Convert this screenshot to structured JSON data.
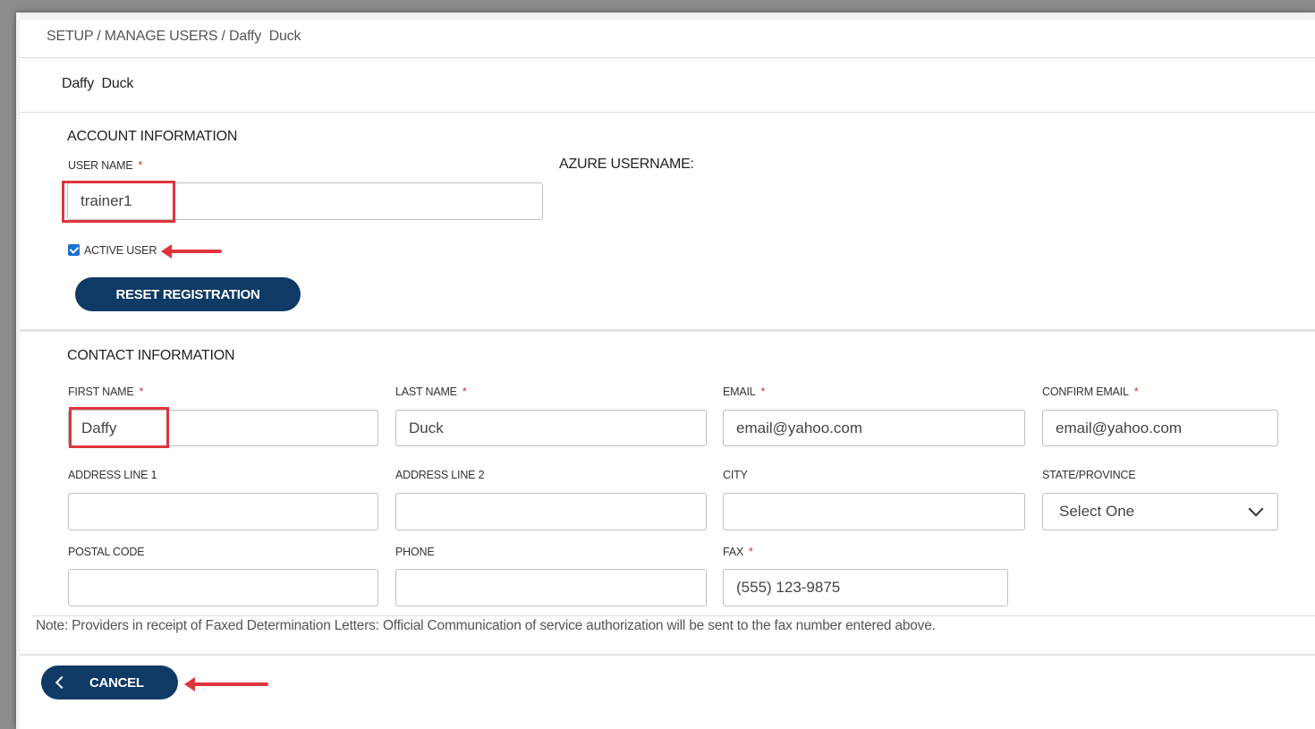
{
  "breadcrumb": "SETUP / MANAGE USERS / Daffy  Duck",
  "page_title": "Daffy  Duck",
  "account": {
    "section_title": "ACCOUNT INFORMATION",
    "user_name_label": "USER NAME",
    "user_name_value": "trainer1",
    "azure_label": "AZURE USERNAME:",
    "active_user_label": "ACTIVE USER",
    "active_user_checked": true,
    "reset_button": "RESET REGISTRATION"
  },
  "contact": {
    "section_title": "CONTACT INFORMATION",
    "first_name_label": "FIRST NAME",
    "first_name_value": "Daffy",
    "last_name_label": "LAST NAME",
    "last_name_value": "Duck",
    "email_label": "EMAIL",
    "email_value": "email@yahoo.com",
    "confirm_email_label": "CONFIRM EMAIL",
    "confirm_email_value": "email@yahoo.com",
    "address1_label": "ADDRESS LINE 1",
    "address1_value": "",
    "address2_label": "ADDRESS LINE 2",
    "address2_value": "",
    "city_label": "CITY",
    "city_value": "",
    "state_label": "STATE/PROVINCE",
    "state_value": "Select One",
    "postal_label": "POSTAL CODE",
    "postal_value": "",
    "phone_label": "PHONE",
    "phone_value": "",
    "fax_label": "FAX",
    "fax_value": "(555) 123-9875"
  },
  "required_marker": "*",
  "note": "Note: Providers in receipt of Faxed Determination Letters: Official Communication of service authorization will be sent to the fax number entered above.",
  "cancel_button": "CANCEL",
  "colors": {
    "button": "#0f3a66",
    "highlight": "#e0343c",
    "required": "#c0392b"
  }
}
